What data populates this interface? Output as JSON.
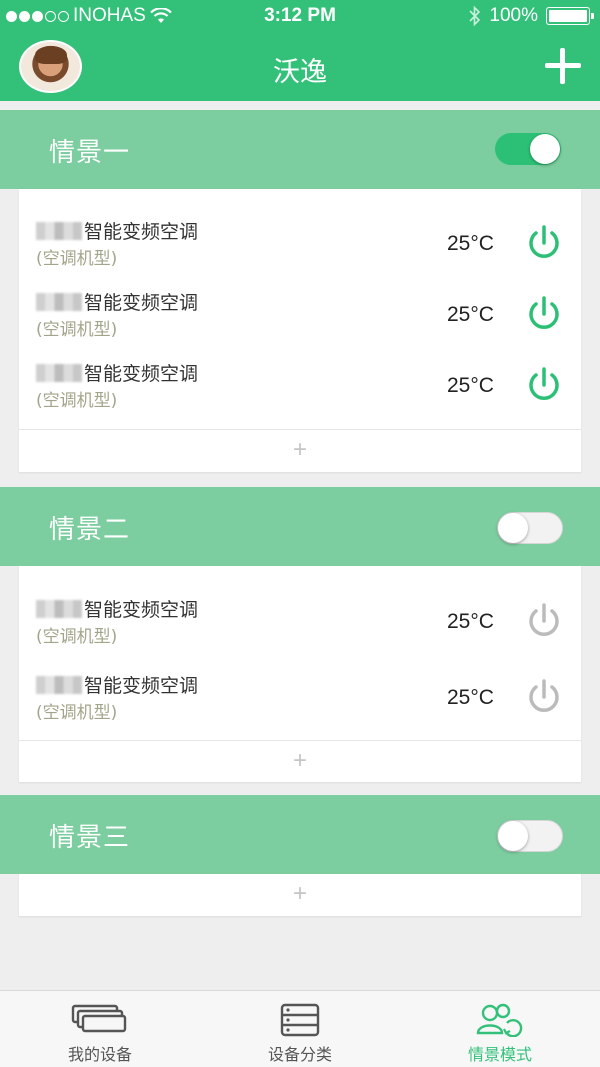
{
  "status_bar": {
    "carrier": "INOHAS",
    "time": "3:12 PM",
    "battery": "100%",
    "icons": [
      "signal-dots-icon",
      "wifi-icon",
      "bluetooth-icon",
      "battery-icon"
    ]
  },
  "nav": {
    "title": "沃逸",
    "add_icon": "plus-icon"
  },
  "colors": {
    "primary": "#33c17a",
    "scene_header": "#7ccd9f",
    "power_on": "#2cc076",
    "power_off": "#bbbbbb",
    "subtitle": "#a3a58a"
  },
  "scenes": [
    {
      "title": "情景一",
      "enabled": true,
      "devices": [
        {
          "name": "智能变频空调",
          "type": "(空调机型)",
          "temp": "25°C",
          "power": "on"
        },
        {
          "name": "智能变频空调",
          "type": "(空调机型)",
          "temp": "25°C",
          "power": "on"
        },
        {
          "name": "智能变频空调",
          "type": "(空调机型)",
          "temp": "25°C",
          "power": "on"
        }
      ],
      "add_label": "+"
    },
    {
      "title": "情景二",
      "enabled": false,
      "devices": [
        {
          "name": "智能变频空调",
          "type": "(空调机型)",
          "temp": "25°C",
          "power": "off"
        },
        {
          "name": "智能变频空调",
          "type": "(空调机型)",
          "temp": "25°C",
          "power": "off"
        }
      ],
      "add_label": "+"
    },
    {
      "title": "情景三",
      "enabled": false,
      "devices": [],
      "add_label": "+"
    }
  ],
  "tabbar": {
    "tabs": [
      {
        "label": "我的设备",
        "icon": "devices-icon",
        "active": false
      },
      {
        "label": "设备分类",
        "icon": "category-icon",
        "active": false
      },
      {
        "label": "情景模式",
        "icon": "scene-mode-icon",
        "active": true
      }
    ]
  }
}
